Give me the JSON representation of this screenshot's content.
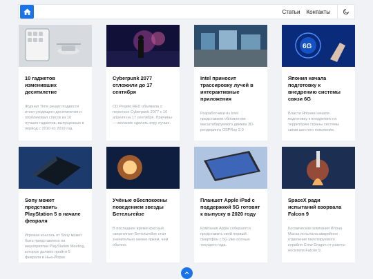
{
  "header": {
    "home_icon": "home-icon",
    "nav": [
      {
        "label": "Статьи"
      },
      {
        "label": "Контакты"
      }
    ],
    "theme_icon": "moon-icon"
  },
  "articles": [
    {
      "title": "10 гаджетов изменивших десятилетие",
      "desc": "Журнал Time решил подвести итоги уходящего десятилетия и опубликовал список из 10 лучших гаджетов, выпущенных в период с 2010 по 2019 год."
    },
    {
      "title": "Cyberpunk 2077 отложили до 17 сентября",
      "desc": "CD Projekt RED объявила о переносе Cyberpunk 2077 с 16 апреля на 17 сентября. Причины — желание сделать игру лучше."
    },
    {
      "title": "Intel приносит трассировку лучей в интерактивные приложения",
      "desc": "Разработчики из Intel представили обновление масштабируемого движка 3D-рендеринга OSPRay 2.0"
    },
    {
      "title": "Япония начала подготовку к внедрению системы связи 6G",
      "desc": "Власти Японии начали подготовку к внедрению на территории страны системы связи шестого поколения."
    },
    {
      "title": "Sony может представить PlayStation 5 в начале февраля",
      "desc": "Игровая консоль от Sony может быть представлена на мероприятии PlayStation Meeting, которое должно пройти 5 февраля в Нью-Йорке."
    },
    {
      "title": "Учёные обеспокоены поведением звезды Бетельгейзе",
      "desc": "В последнее время красный сверхгигант Бетельгейзе стал значительно менее ярким, чем обычно."
    },
    {
      "title": "Планшет Apple iPad с поддержкой 5G готовят к выпуску в 2020 году",
      "desc": "Компания Apple собирается представить свой первый смартфон с 5G уже осенью текущего года."
    },
    {
      "title": "SpaceX ради испытаний взорвала Falcon 9",
      "desc": "Космическая компания Илона Маска испытала аварийное отделение пилотируемого корабля Crew Dragon от ракеты-носителя Falcon 9."
    }
  ],
  "scroll_top_icon": "chevron-up-icon",
  "colors": {
    "accent": "#1a73e8",
    "background": "#f0f2f5",
    "card": "#ffffff",
    "muted_text": "#9aa0a6"
  }
}
